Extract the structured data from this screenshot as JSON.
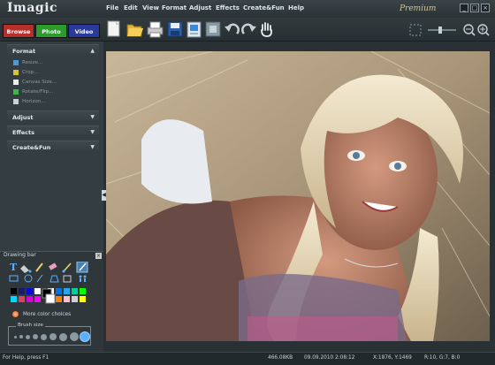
{
  "app": {
    "title": "Imagic",
    "edition": "Premium"
  },
  "menu": [
    "File",
    "Edit",
    "View",
    "Format",
    "Adjust",
    "Effects",
    "Create&Fun",
    "Help"
  ],
  "modes": [
    {
      "label": "Browse",
      "color": "#b5302b"
    },
    {
      "label": "Photo",
      "color": "#2f9a2c"
    },
    {
      "label": "Video",
      "color": "#2a3a9c"
    }
  ],
  "toolbar_icons": [
    "new-document-icon",
    "open-folder-icon",
    "print-icon",
    "save-icon",
    "image-info-icon",
    "frame-icon",
    "undo-icon",
    "redo-icon",
    "hand-pan-icon"
  ],
  "zoom_icons": [
    "zoom-slider",
    "zoom-out-icon",
    "zoom-in-icon"
  ],
  "left_panel": {
    "format": {
      "title": "Format",
      "items": [
        {
          "label": "Resize...",
          "icon": "resize-icon"
        },
        {
          "label": "Crop...",
          "icon": "crop-icon"
        },
        {
          "label": "Canvas Size...",
          "icon": "canvas-size-icon"
        },
        {
          "label": "Rotate/Flip...",
          "icon": "rotate-icon"
        },
        {
          "label": "Horizon...",
          "icon": "horizon-icon"
        }
      ]
    },
    "sections": [
      "Adjust",
      "Effects",
      "Create&Fun"
    ]
  },
  "drawing_bar": {
    "title": "Drawing bar",
    "more_colors": "More color choices",
    "brush_size_label": "Brush size",
    "palette_row1": [
      "#000000",
      "#1a1a6e",
      "#0b0bd0",
      "#ffffff",
      "#ffffff",
      "#0a6fe0",
      "#28a8e8",
      "#00d0a0",
      "#00ff00"
    ],
    "palette_row2": [
      "#00d8ff",
      "#e04060",
      "#d800d8",
      "#ff00ff",
      "#ffffff",
      "#ff8000",
      "#ffc0cb",
      "#d0d0d0",
      "#ffff00"
    ]
  },
  "status": {
    "help": "For Help, press F1",
    "size": "466.08KB",
    "date": "09.09.2010 2:08:12",
    "coords": "X:1876, Y:1469",
    "color": "R:10, G:7, B:0"
  }
}
